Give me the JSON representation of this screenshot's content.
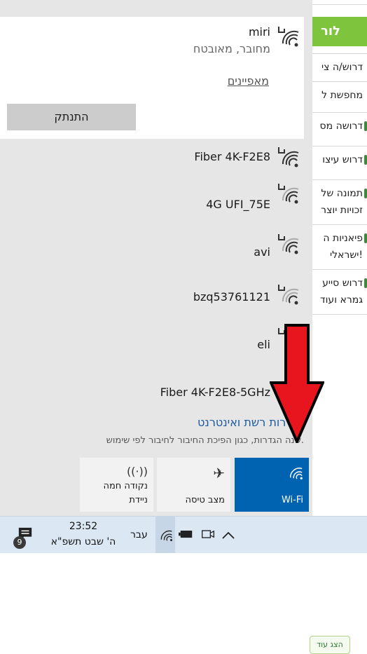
{
  "background_app": {
    "header": "לור",
    "items": [
      "דרוש/ה צי",
      "מחפשת ל",
      "דרושה מס",
      "דרוש עיצו",
      "תמונה של",
      "זכויות יוצר",
      "פיאניות ה",
      "ישראלי!",
      "דרוש סייע",
      "גמרא ועוד"
    ],
    "show_button": "הצג עוד"
  },
  "wifi": {
    "connected": {
      "ssid": "miri",
      "status": "מחובר, מאובטח",
      "properties_link": "מאפיינים",
      "disconnect_label": "התנתק"
    },
    "networks": [
      {
        "ssid": "Fiber 4K-F2E8",
        "secured": true
      },
      {
        "ssid": "4G UFI_75E",
        "secured": true
      },
      {
        "ssid": "avi",
        "secured": true
      },
      {
        "ssid": "bzq53761121",
        "secured": true
      },
      {
        "ssid": "eli",
        "secured": true
      },
      {
        "ssid": "Fiber 4K-F2E8-5GHz",
        "secured": false
      }
    ],
    "settings_title": "הגדרות רשת ואינטרנט",
    "settings_subtitle": "שנה הגדרות, כגון הפיכת החיבור לחיבור לפי שימוש.",
    "tiles": {
      "wifi": "Wi-Fi",
      "airplane": "מצב טיסה",
      "hotspot_line1": "נקודה חמה",
      "hotspot_line2": "ניידת"
    }
  },
  "taskbar": {
    "time": "23:52",
    "date": "ה' שבט תשפ\"א",
    "language": "עבר",
    "notification_count": "9"
  },
  "colors": {
    "accent": "#0063b1",
    "arrow": "#e8141e",
    "link": "#1c5aa0"
  }
}
